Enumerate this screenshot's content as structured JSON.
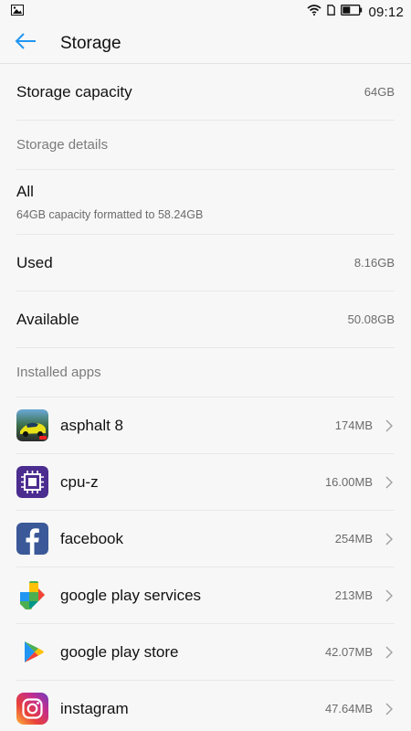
{
  "status_bar": {
    "time": "09:12"
  },
  "app_bar": {
    "title": "Storage"
  },
  "storage": {
    "capacity_label": "Storage capacity",
    "capacity_value": "64GB"
  },
  "details": {
    "header": "Storage details",
    "all_label": "All",
    "all_sub": "64GB capacity formatted to 58.24GB",
    "used_label": "Used",
    "used_value": "8.16GB",
    "available_label": "Available",
    "available_value": "50.08GB"
  },
  "installed": {
    "header": "Installed apps",
    "apps": [
      {
        "name": "asphalt 8",
        "size": "174MB",
        "icon": "asphalt-8-icon"
      },
      {
        "name": "cpu-z",
        "size": "16.00MB",
        "icon": "cpu-z-icon"
      },
      {
        "name": "facebook",
        "size": "254MB",
        "icon": "facebook-icon"
      },
      {
        "name": "google play services",
        "size": "213MB",
        "icon": "google-play-services-icon"
      },
      {
        "name": "google play store",
        "size": "42.07MB",
        "icon": "google-play-store-icon"
      },
      {
        "name": "instagram",
        "size": "47.64MB",
        "icon": "instagram-icon"
      }
    ]
  },
  "colors": {
    "accent": "#2196f3",
    "facebook": "#3b5998",
    "cpuz": "#4b2c8f"
  }
}
